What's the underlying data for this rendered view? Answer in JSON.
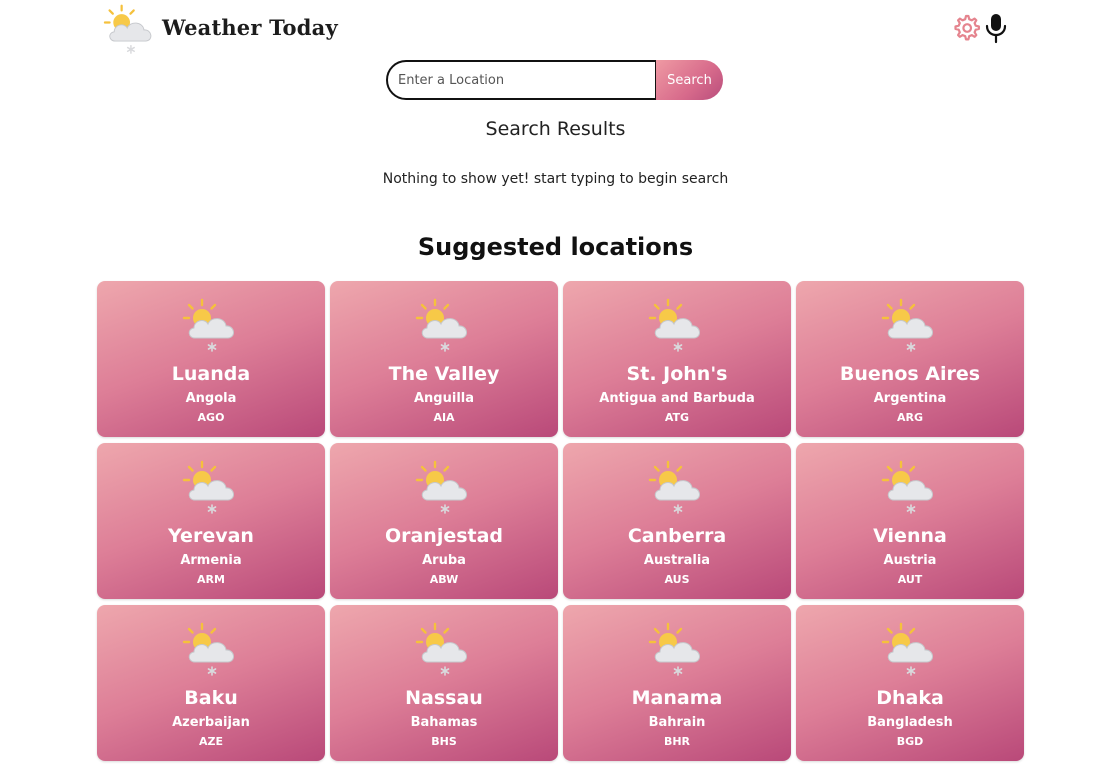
{
  "header": {
    "brand": "Weather Today",
    "logo_icon": "sun-cloud-snow-icon",
    "settings_icon": "gear-icon",
    "mic_icon": "microphone-icon"
  },
  "search": {
    "placeholder": "Enter a Location",
    "value": "",
    "button_label": "Search"
  },
  "results": {
    "title": "Search Results",
    "empty_message": "Nothing to show yet! start typing to begin search"
  },
  "suggested": {
    "title": "Suggested locations",
    "cards": [
      {
        "city": "Luanda",
        "country": "Angola",
        "code": "AGO"
      },
      {
        "city": "The Valley",
        "country": "Anguilla",
        "code": "AIA"
      },
      {
        "city": "St. John's",
        "country": "Antigua and Barbuda",
        "code": "ATG"
      },
      {
        "city": "Buenos Aires",
        "country": "Argentina",
        "code": "ARG"
      },
      {
        "city": "Yerevan",
        "country": "Armenia",
        "code": "ARM"
      },
      {
        "city": "Oranjestad",
        "country": "Aruba",
        "code": "ABW"
      },
      {
        "city": "Canberra",
        "country": "Australia",
        "code": "AUS"
      },
      {
        "city": "Vienna",
        "country": "Austria",
        "code": "AUT"
      },
      {
        "city": "Baku",
        "country": "Azerbaijan",
        "code": "AZE"
      },
      {
        "city": "Nassau",
        "country": "Bahamas",
        "code": "BHS"
      },
      {
        "city": "Manama",
        "country": "Bahrain",
        "code": "BHR"
      },
      {
        "city": "Dhaka",
        "country": "Bangladesh",
        "code": "BGD"
      }
    ]
  },
  "colors": {
    "card_gradient_start": "#eea7ad",
    "card_gradient_end": "#b94979",
    "accent": "#e07a8c",
    "sun": "#f5c542"
  }
}
